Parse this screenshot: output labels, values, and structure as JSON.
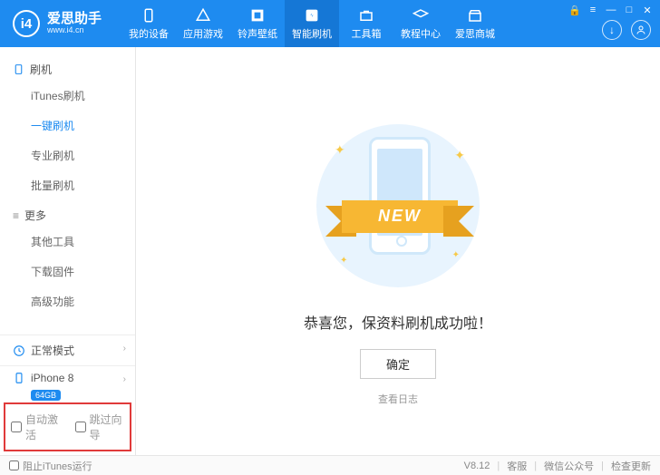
{
  "logo": {
    "short": "i4",
    "title": "爱思助手",
    "sub": "www.i4.cn"
  },
  "nav": [
    {
      "label": "我的设备"
    },
    {
      "label": "应用游戏"
    },
    {
      "label": "铃声壁纸"
    },
    {
      "label": "智能刷机"
    },
    {
      "label": "工具箱"
    },
    {
      "label": "教程中心"
    },
    {
      "label": "爱思商城"
    }
  ],
  "win": {
    "lock": "🔒",
    "menu": "≡",
    "min": "—",
    "max": "□",
    "close": "✕"
  },
  "hdr_btn": {
    "download": "↓",
    "user": "👤"
  },
  "sidebar": {
    "sec1": "刷机",
    "sec2": "更多",
    "items1": [
      "iTunes刷机",
      "一键刷机",
      "专业刷机",
      "批量刷机"
    ],
    "items2": [
      "其他工具",
      "下载固件",
      "高级功能"
    ]
  },
  "mode": {
    "label": "正常模式"
  },
  "device": {
    "name": "iPhone 8",
    "storage": "64GB"
  },
  "opts": {
    "auto": "自动激活",
    "skip": "跳过向导"
  },
  "main": {
    "ribbon": "NEW",
    "success": "恭喜您，保资料刷机成功啦！",
    "ok": "确定",
    "log": "查看日志"
  },
  "footer": {
    "block": "阻止iTunes运行",
    "version": "V8.12",
    "service": "客服",
    "wechat": "微信公众号",
    "update": "检查更新"
  }
}
